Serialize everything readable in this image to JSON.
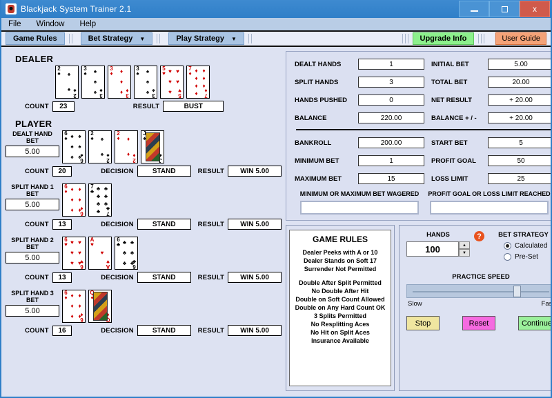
{
  "window": {
    "title": "Blackjack System Trainer 2.1",
    "icon": "app-icon",
    "minimize": "–",
    "maximize": "□",
    "close": "x"
  },
  "menubar": {
    "items": [
      "File",
      "Window",
      "Help"
    ]
  },
  "toolbar": {
    "buttons": [
      {
        "label": "Game Rules",
        "caret": false
      },
      {
        "label": "Bet Strategy",
        "caret": true
      },
      {
        "label": "Play Strategy",
        "caret": true
      }
    ],
    "upgrade_label": "Upgrade Info",
    "guide_label": "User Guide",
    "upgrade_color": "#8cf08c",
    "guide_color": "#f4a277"
  },
  "dealer": {
    "heading": "DEALER",
    "cards": [
      {
        "rank": "2",
        "suit": "♠",
        "color": "black"
      },
      {
        "rank": "3",
        "suit": "♠",
        "color": "black"
      },
      {
        "rank": "3",
        "suit": "♦",
        "color": "red"
      },
      {
        "rank": "3",
        "suit": "♠",
        "color": "black"
      },
      {
        "rank": "5",
        "suit": "♥",
        "color": "red"
      },
      {
        "rank": "7",
        "suit": "♦",
        "color": "red"
      }
    ],
    "count_label": "COUNT",
    "count_value": "23",
    "result_label": "RESULT",
    "result_value": "BUST"
  },
  "player": {
    "heading": "PLAYER",
    "hands": [
      {
        "name": "DEALT HAND",
        "bet_label": "BET",
        "bet_value": "5.00",
        "cards": [
          {
            "rank": "6",
            "suit": "♠",
            "color": "black"
          },
          {
            "rank": "2",
            "suit": "♠",
            "color": "black"
          },
          {
            "rank": "2",
            "suit": "♦",
            "color": "red"
          },
          {
            "rank": "J",
            "suit": "♠",
            "color": "black",
            "face": true
          }
        ],
        "count_label": "COUNT",
        "count_value": "20",
        "decision_label": "DECISION",
        "decision_value": "STAND",
        "result_label": "RESULT",
        "result_value": "WIN   5.00"
      },
      {
        "name": "SPLIT HAND 1",
        "bet_label": "BET",
        "bet_value": "5.00",
        "cards": [
          {
            "rank": "6",
            "suit": "♦",
            "color": "red"
          },
          {
            "rank": "7",
            "suit": "♣",
            "color": "black"
          }
        ],
        "count_label": "COUNT",
        "count_value": "13",
        "decision_label": "DECISION",
        "decision_value": "STAND",
        "result_label": "RESULT",
        "result_value": "WIN   5.00"
      },
      {
        "name": "SPLIT HAND 2",
        "bet_label": "BET",
        "bet_value": "5.00",
        "cards": [
          {
            "rank": "6",
            "suit": "♥",
            "color": "red"
          },
          {
            "rank": "A",
            "suit": "♥",
            "color": "red"
          },
          {
            "rank": "6",
            "suit": "♣",
            "color": "black"
          }
        ],
        "count_label": "COUNT",
        "count_value": "13",
        "decision_label": "DECISION",
        "decision_value": "STAND",
        "result_label": "RESULT",
        "result_value": "WIN   5.00"
      },
      {
        "name": "SPLIT HAND 3",
        "bet_label": "BET",
        "bet_value": "5.00",
        "cards": [
          {
            "rank": "6",
            "suit": "♦",
            "color": "red"
          },
          {
            "rank": "Q",
            "suit": "♦",
            "color": "red",
            "face": true
          }
        ],
        "count_label": "COUNT",
        "count_value": "16",
        "decision_label": "DECISION",
        "decision_value": "STAND",
        "result_label": "RESULT",
        "result_value": "WIN   5.00"
      }
    ]
  },
  "stats": {
    "rows_top": [
      {
        "l1": "DEALT HANDS",
        "v1": "1",
        "l2": "INITIAL BET",
        "v2": "5.00"
      },
      {
        "l1": "SPLIT HANDS",
        "v1": "3",
        "l2": "TOTAL BET",
        "v2": "20.00"
      },
      {
        "l1": "HANDS PUSHED",
        "v1": "0",
        "l2": "NET RESULT",
        "v2": "+ 20.00"
      },
      {
        "l1": "BALANCE",
        "v1": "220.00",
        "l2": "BALANCE  + / -",
        "v2": "+ 20.00"
      }
    ],
    "rows_bottom": [
      {
        "l1": "BANKROLL",
        "v1": "200.00",
        "l2": "START BET",
        "v2": "5"
      },
      {
        "l1": "MINIMUM BET",
        "v1": "1",
        "l2": "PROFIT GOAL",
        "v2": "50"
      },
      {
        "l1": "MAXIMUM BET",
        "v1": "15",
        "l2": "LOSS LIMIT",
        "v2": "25"
      }
    ],
    "note_left": "MINIMUM OR MAXIMUM BET WAGERED",
    "note_left_value": "",
    "note_right": "PROFIT GOAL OR LOSS LIMIT REACHED",
    "note_right_value": ""
  },
  "game_rules": {
    "title": "GAME RULES",
    "group1": [
      "Dealer Peeks with A or 10",
      "Dealer Stands on Soft 17",
      "Surrender Not Permitted"
    ],
    "group2": [
      "Double After Split Permitted",
      "No Double After Hit",
      "Double on Soft Count Allowed",
      "Double on Any Hard Count OK",
      "3 Splits Permitted",
      "No Resplitting Aces",
      "No Hit on Split Aces",
      "Insurance Available"
    ]
  },
  "controls": {
    "hands_label": "HANDS",
    "hands_value": "100",
    "help_glyph": "?",
    "spin_up": "▲",
    "spin_down": "▼",
    "bet_strategy_title": "BET STRATEGY",
    "bet_options": [
      {
        "label": "Calculated",
        "selected": true
      },
      {
        "label": "Pre-Set",
        "selected": false
      }
    ],
    "speed_title": "PRACTICE SPEED",
    "speed_slow": "Slow",
    "speed_fast": "Fast",
    "speed_percent": 72,
    "stop_label": "Stop",
    "reset_label": "Reset",
    "continue_label": "Continue",
    "stop_color": "#f0e6a0",
    "reset_color": "#f56ae0",
    "continue_color": "#9bf09b"
  }
}
